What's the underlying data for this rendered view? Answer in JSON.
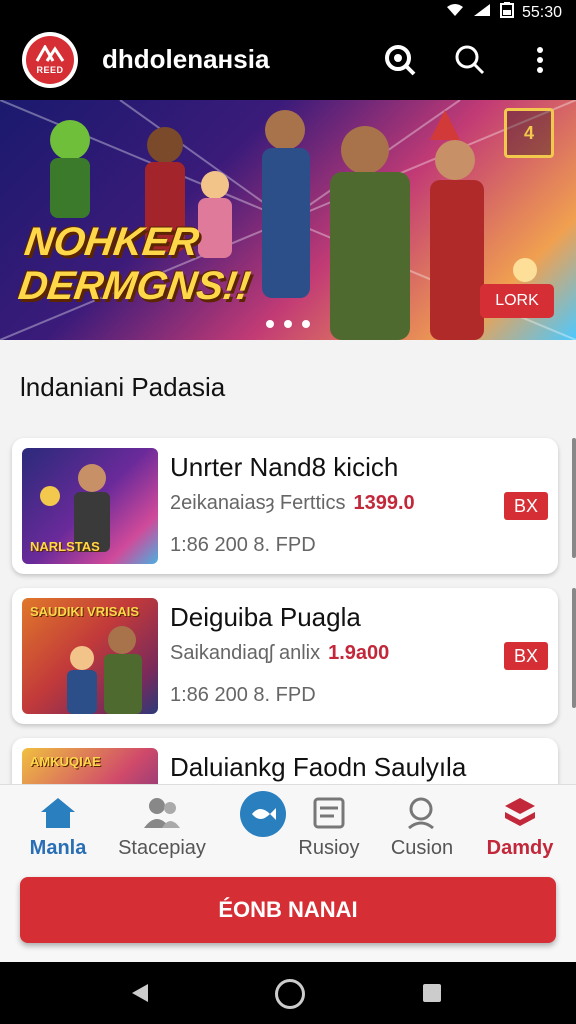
{
  "status": {
    "time": "55:30"
  },
  "app": {
    "title": "dhdolenaнsia",
    "logo_text": "REED"
  },
  "banner": {
    "title_line1": "NOHKER",
    "title_line2": "DERMGNS!!",
    "cta": "LORK",
    "badge": "4"
  },
  "section": {
    "title": "lndaniani Padasia"
  },
  "cards": [
    {
      "title": "Unrter Nand8 kicich",
      "subtitle": "2eikanaiasȝ Ferttics",
      "price": "1399.0",
      "meta": "1:86 200 8. FPD",
      "tag": "BX",
      "thumb_text": "NARLSTAS"
    },
    {
      "title": "Deiguiba Puagla",
      "subtitle": "Saikandiaqʃ anlix",
      "price": "1.9a00",
      "meta": "1:86 200 8. FPD",
      "tag": "BX",
      "thumb_text": "SAUDIKI VRISAIS"
    },
    {
      "title": "Daluiankg Faodn Saulyıla",
      "thumb_text": "AMKUQIAE"
    }
  ],
  "nav": {
    "items": [
      {
        "label": "Manla",
        "icon": "home-icon"
      },
      {
        "label": "Stacepiay",
        "icon": "people-icon"
      },
      {
        "label": "",
        "icon": "fish-icon"
      },
      {
        "label": "Rusioy",
        "icon": "document-icon"
      },
      {
        "label": "Cusion",
        "icon": "search-person-icon"
      },
      {
        "label": "Damdy",
        "icon": "layers-icon"
      }
    ]
  },
  "primary_button": {
    "label": "ÉONB NANAI"
  },
  "colors": {
    "accent_red": "#d62e35",
    "accent_blue": "#2a6fb5",
    "price_red": "#c2283a"
  }
}
